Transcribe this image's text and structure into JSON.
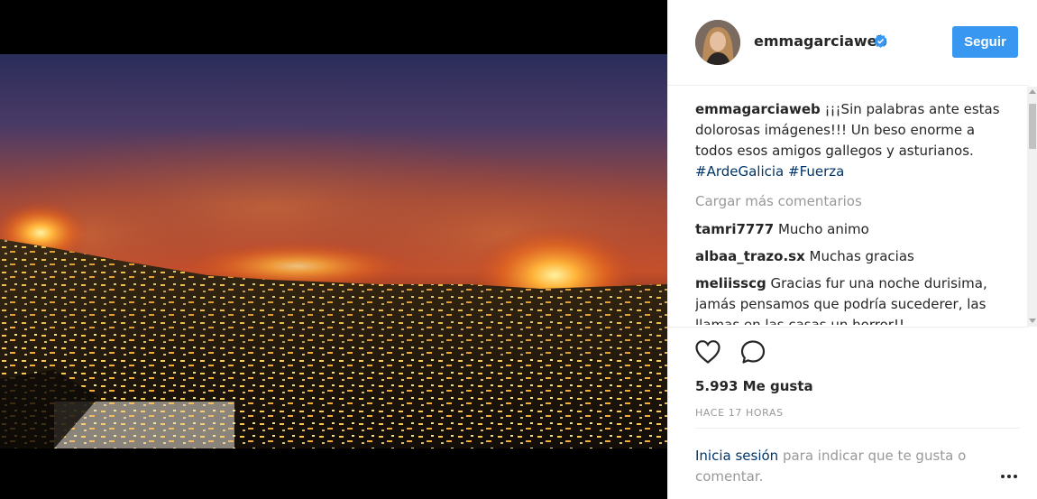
{
  "post": {
    "username": "emmagarciaweb",
    "follow_label": "Seguir",
    "caption_user": "emmagarciaweb",
    "caption_text": " ¡¡¡Sin palabras ante estas dolorosas imágenes!!! Un beso enorme a todos esos amigos gallegos y asturianos. ",
    "hashtags": [
      "#ArdeGalicia",
      "#Fuerza"
    ],
    "load_more_label": "Cargar más comentarios",
    "comments": [
      {
        "user": "tamri7777",
        "text": " Mucho animo"
      },
      {
        "user": "albaa_trazo.sx",
        "text": " Muchas gracias"
      },
      {
        "user": "meliisscg",
        "text": " Gracias fur una noche durisima, jamás pensamos que podría sucederer, las llamas en las casas un horror!!"
      }
    ],
    "likes": "5.993 Me gusta",
    "timestamp": "HACE 17 HORAS",
    "login_link": "Inicia sesión",
    "login_rest": " para indicar que te gusta o comentar."
  },
  "icons": {
    "verified": "verified-badge-icon",
    "like": "heart-icon",
    "comment": "speech-bubble-icon",
    "more": "more-options-icon"
  },
  "colors": {
    "accent": "#3897f0",
    "link": "#003569",
    "muted": "#999999"
  }
}
